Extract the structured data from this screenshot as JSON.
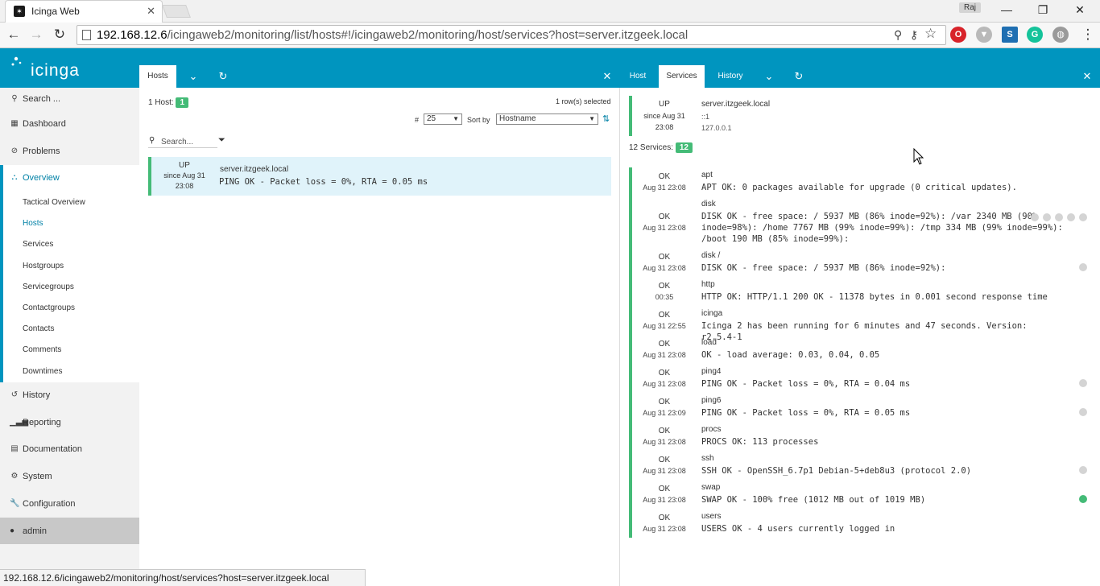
{
  "browser": {
    "tab_title": "Icinga Web",
    "user_badge": "Raj",
    "url_host": "192.168.12.6",
    "url_path": "/icingaweb2/monitoring/list/hosts#!/icingaweb2/monitoring/host/services?host=server.itzgeek.local",
    "status_url": "192.168.12.6/icingaweb2/monitoring/host/services?host=server.itzgeek.local"
  },
  "app": {
    "logo": "icinga"
  },
  "sidebar": {
    "search": "Search ...",
    "dashboard": "Dashboard",
    "problems": "Problems",
    "overview": "Overview",
    "overview_items": [
      "Tactical Overview",
      "Hosts",
      "Services",
      "Hostgroups",
      "Servicegroups",
      "Contactgroups",
      "Contacts",
      "Comments",
      "Downtimes"
    ],
    "history": "History",
    "reporting": "Reporting",
    "documentation": "Documentation",
    "system": "System",
    "configuration": "Configuration",
    "admin": "admin"
  },
  "left": {
    "tab": "Hosts",
    "hosts_label": "1 Host:",
    "hosts_count": "1",
    "rows_selected": "1 row(s) selected",
    "limit_label": "#",
    "limit_value": "25",
    "sort_label": "Sort by",
    "sort_value": "Hostname",
    "search_placeholder": "Search...",
    "host": {
      "state": "UP",
      "since": "since Aug 31",
      "time": "23:08",
      "name": "server.itzgeek.local",
      "output": "PING OK - Packet loss = 0%, RTA = 0.05 ms"
    }
  },
  "right": {
    "tabs": [
      "Host",
      "Services",
      "History"
    ],
    "host": {
      "state": "UP",
      "since": "since Aug 31",
      "time": "23:08",
      "name": "server.itzgeek.local",
      "ipv6": "::1",
      "ipv4": "127.0.0.1"
    },
    "services_label": "12 Services:",
    "services_count": "12",
    "services": [
      {
        "state": "OK",
        "time": "Aug 31 23:08",
        "name": "apt",
        "output": "APT OK: 0 packages available for upgrade (0 critical updates)."
      },
      {
        "state": "OK",
        "time": "Aug 31 23:08",
        "name": "disk",
        "output": "DISK OK - free space: / 5937 MB (86% inode=92%): /var 2340 MB (90% inode=98%): /home 7767 MB (99% inode=99%): /tmp 334 MB (99% inode=99%): /boot 190 MB (85% inode=99%):"
      },
      {
        "state": "OK",
        "time": "Aug 31 23:08",
        "name": "disk /",
        "output": "DISK OK - free space: / 5937 MB (86% inode=92%):"
      },
      {
        "state": "OK",
        "time": "00:35",
        "name": "http",
        "output": "HTTP OK: HTTP/1.1 200 OK - 11378 bytes in 0.001 second response time"
      },
      {
        "state": "OK",
        "time": "Aug 31 22:55",
        "name": "icinga",
        "output": "Icinga 2 has been running for 6 minutes and 47 seconds. Version: r2.5.4-1"
      },
      {
        "state": "OK",
        "time": "Aug 31 23:08",
        "name": "load",
        "output": "OK - load average: 0.03, 0.04, 0.05"
      },
      {
        "state": "OK",
        "time": "Aug 31 23:08",
        "name": "ping4",
        "output": "PING OK - Packet loss = 0%, RTA = 0.04 ms"
      },
      {
        "state": "OK",
        "time": "Aug 31 23:09",
        "name": "ping6",
        "output": "PING OK - Packet loss = 0%, RTA = 0.05 ms"
      },
      {
        "state": "OK",
        "time": "Aug 31 23:08",
        "name": "procs",
        "output": "PROCS OK: 113 processes"
      },
      {
        "state": "OK",
        "time": "Aug 31 23:08",
        "name": "ssh",
        "output": "SSH OK - OpenSSH_6.7p1 Debian-5+deb8u3 (protocol 2.0)"
      },
      {
        "state": "OK",
        "time": "Aug 31 23:08",
        "name": "swap",
        "output": "SWAP OK - 100% free (1012 MB out of 1019 MB)"
      },
      {
        "state": "OK",
        "time": "Aug 31 23:08",
        "name": "users",
        "output": "USERS OK - 4 users currently logged in"
      }
    ]
  },
  "colors": {
    "brand": "#0095bf",
    "ok": "#44bb77"
  }
}
